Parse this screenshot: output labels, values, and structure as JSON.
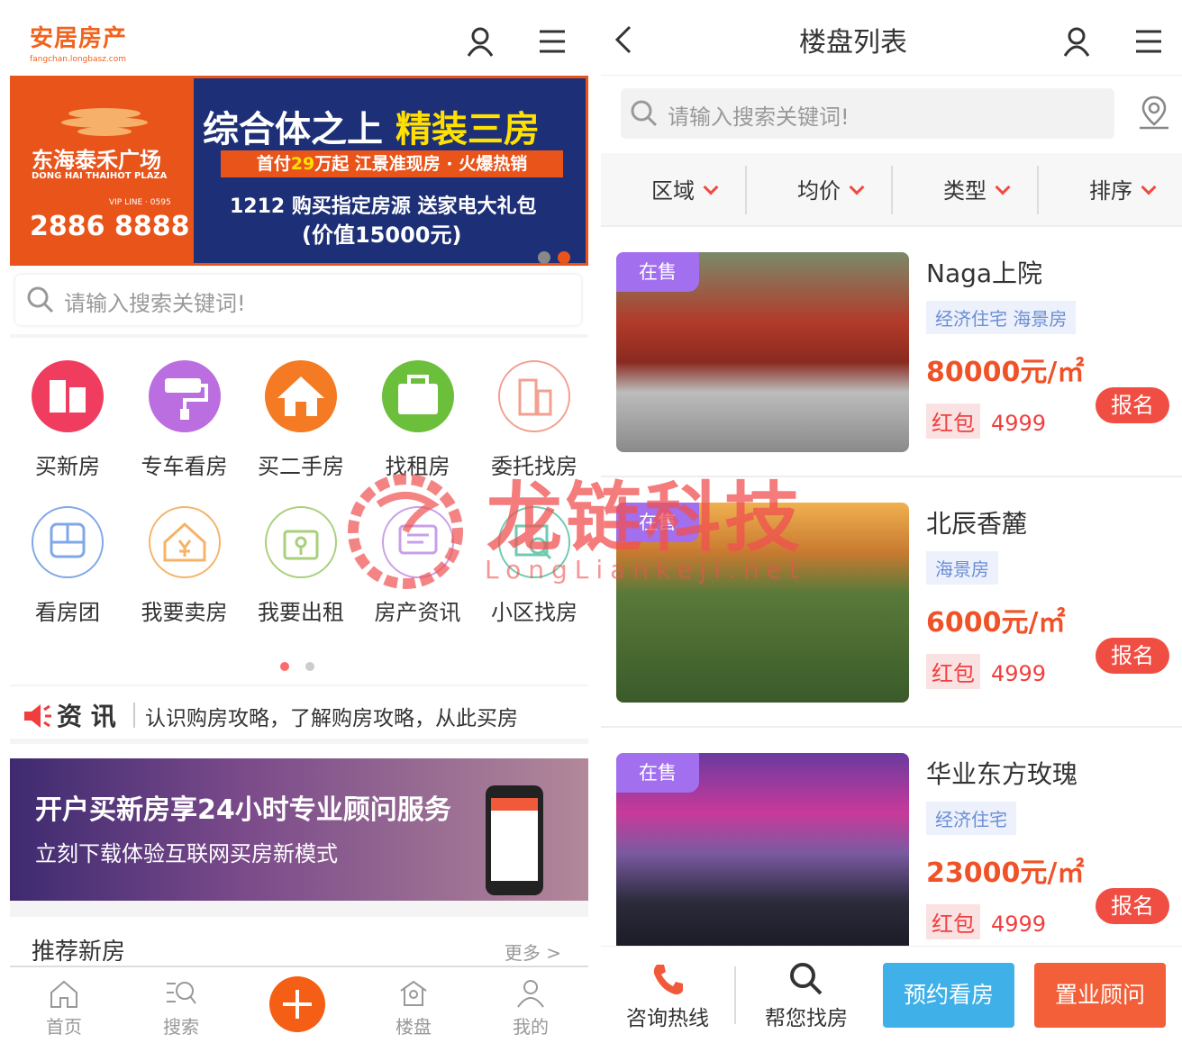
{
  "left": {
    "logo": {
      "title": "安居房产",
      "subtitle": "fangchan.longbasz.com"
    },
    "banner": {
      "brand": "东海泰禾广场",
      "brand_en": "DONG HAI THAIHOT PLAZA",
      "vip": "VIP LINE · 0595",
      "phone": "2886 8888",
      "headline_a": "综合体之上",
      "headline_b": "精装三房",
      "line2_a": "首付",
      "line2_b": "29",
      "line2_c": "万起 江景准现房 · 火爆热销",
      "line3": "1212 购买指定房源 送家电大礼包",
      "line4": "(价值15000元)"
    },
    "search": {
      "placeholder": "请输入搜索关键词!"
    },
    "grid": [
      {
        "label": "买新房",
        "icon": "building-icon",
        "color": "#f03d5f"
      },
      {
        "label": "专车看房",
        "icon": "paint-roller-icon",
        "color": "#bb6ee0"
      },
      {
        "label": "买二手房",
        "icon": "home-icon",
        "color": "#f47a24"
      },
      {
        "label": "找租房",
        "icon": "bag-icon",
        "color": "#6cbf3a"
      },
      {
        "label": "委托找房",
        "icon": "office-icon",
        "color": "#f2a090"
      },
      {
        "label": "看房团",
        "icon": "bus-icon",
        "color": "#7fa8e8"
      },
      {
        "label": "我要卖房",
        "icon": "house-yen-icon",
        "color": "#f5b36a"
      },
      {
        "label": "我要出租",
        "icon": "key-bag-icon",
        "color": "#a8d07a"
      },
      {
        "label": "房产资讯",
        "icon": "chat-icon",
        "color": "#c8a0e8"
      },
      {
        "label": "小区找房",
        "icon": "map-search-icon",
        "color": "#6fcab0"
      }
    ],
    "news": {
      "tag": "资 讯",
      "text": "认识购房攻略，了解购房攻略，从此买房"
    },
    "promo": {
      "line1": "开户买新房享24小时专业顾问服务",
      "line2": "立刻下载体验互联网买房新模式"
    },
    "recommend": {
      "title": "推荐新房",
      "more": "更多 >"
    },
    "tabs": [
      {
        "label": "首页",
        "icon": "home-outline-icon"
      },
      {
        "label": "搜索",
        "icon": "search-list-icon"
      },
      {
        "label": "",
        "icon": "plus-icon"
      },
      {
        "label": "楼盘",
        "icon": "building-outline-icon"
      },
      {
        "label": "我的",
        "icon": "user-outline-icon"
      }
    ]
  },
  "right": {
    "title": "楼盘列表",
    "search": {
      "placeholder": "请输入搜索关键词!"
    },
    "filters": [
      "区域",
      "均价",
      "类型",
      "排序"
    ],
    "items": [
      {
        "status": "在售",
        "name": "Naga上院",
        "tags": [
          "经济住宅 海景房"
        ],
        "price": "80000元/㎡",
        "red_label": "红包",
        "red_value": "4999",
        "button": "报名"
      },
      {
        "status": "在售",
        "name": "北辰香麓",
        "tags": [
          "海景房"
        ],
        "price": "6000元/㎡",
        "red_label": "红包",
        "red_value": "4999",
        "button": "报名"
      },
      {
        "status": "在售",
        "name": "华业东方玫瑰",
        "tags": [
          "经济住宅"
        ],
        "price": "23000元/㎡",
        "red_label": "红包",
        "red_value": "4999",
        "button": "报名"
      }
    ],
    "bottom": {
      "hotline": "咨询热线",
      "find": "帮您找房",
      "book": "预约看房",
      "advisor": "置业顾问"
    }
  },
  "watermark": {
    "title": "龙链科技",
    "url": "LongLiankeji.net"
  },
  "colors": {
    "brand": "#f2621c",
    "accent": "#f04e42",
    "sale_badge": "#a26fef",
    "book_btn": "#3fb0e8"
  }
}
